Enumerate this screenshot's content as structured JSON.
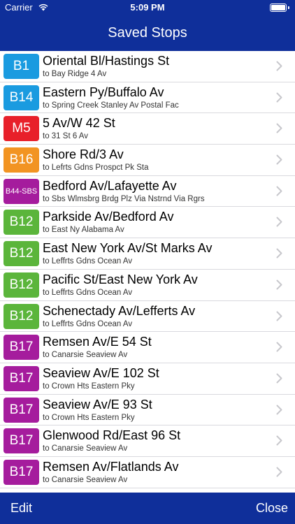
{
  "status_bar": {
    "carrier": "Carrier",
    "time": "5:09 PM"
  },
  "nav": {
    "title": "Saved Stops"
  },
  "stops": [
    {
      "route": "B1",
      "color": "#1a9be0",
      "name": "Oriental Bl/Hastings St",
      "dest": "to Bay Ridge 4 Av"
    },
    {
      "route": "B14",
      "color": "#1a9be0",
      "name": "Eastern Py/Buffalo Av",
      "dest": "to Spring Creek Stanley Av Postal Fac"
    },
    {
      "route": "M5",
      "color": "#e8202a",
      "name": "5 Av/W 42 St",
      "dest": "to 31 St 6 Av"
    },
    {
      "route": "B16",
      "color": "#f29422",
      "name": "Shore Rd/3 Av",
      "dest": "to Lefrts Gdns Prospct Pk Sta"
    },
    {
      "route": "B44-SBS",
      "color": "#a51c9d",
      "name": "Bedford Av/Lafayette Av",
      "dest": "to Sbs Wlmsbrg Brdg Plz Via Nstrnd Via Rgrs"
    },
    {
      "route": "B12",
      "color": "#5bb53b",
      "name": "Parkside Av/Bedford Av",
      "dest": "to East Ny Alabama Av"
    },
    {
      "route": "B12",
      "color": "#5bb53b",
      "name": "East New York Av/St Marks Av",
      "dest": "to Leffrts Gdns Ocean Av"
    },
    {
      "route": "B12",
      "color": "#5bb53b",
      "name": "Pacific St/East New York Av",
      "dest": "to Leffrts Gdns Ocean Av"
    },
    {
      "route": "B12",
      "color": "#5bb53b",
      "name": "Schenectady Av/Lefferts Av",
      "dest": "to Leffrts Gdns Ocean Av"
    },
    {
      "route": "B17",
      "color": "#a51c9d",
      "name": "Remsen Av/E 54 St",
      "dest": "to Canarsie Seaview Av"
    },
    {
      "route": "B17",
      "color": "#a51c9d",
      "name": "Seaview Av/E 102 St",
      "dest": "to Crown Hts Eastern Pky"
    },
    {
      "route": "B17",
      "color": "#a51c9d",
      "name": "Seaview Av/E 93 St",
      "dest": "to Crown Hts Eastern Pky"
    },
    {
      "route": "B17",
      "color": "#a51c9d",
      "name": "Glenwood Rd/East 96 St",
      "dest": "to Canarsie Seaview Av"
    },
    {
      "route": "B17",
      "color": "#a51c9d",
      "name": "Remsen Av/Flatlands Av",
      "dest": "to Canarsie Seaview Av"
    }
  ],
  "toolbar": {
    "edit_label": "Edit",
    "close_label": "Close"
  },
  "colors": {
    "bar": "#0f2f9a",
    "separator": "#d9d9de",
    "chevron": "#c7c7cc"
  }
}
